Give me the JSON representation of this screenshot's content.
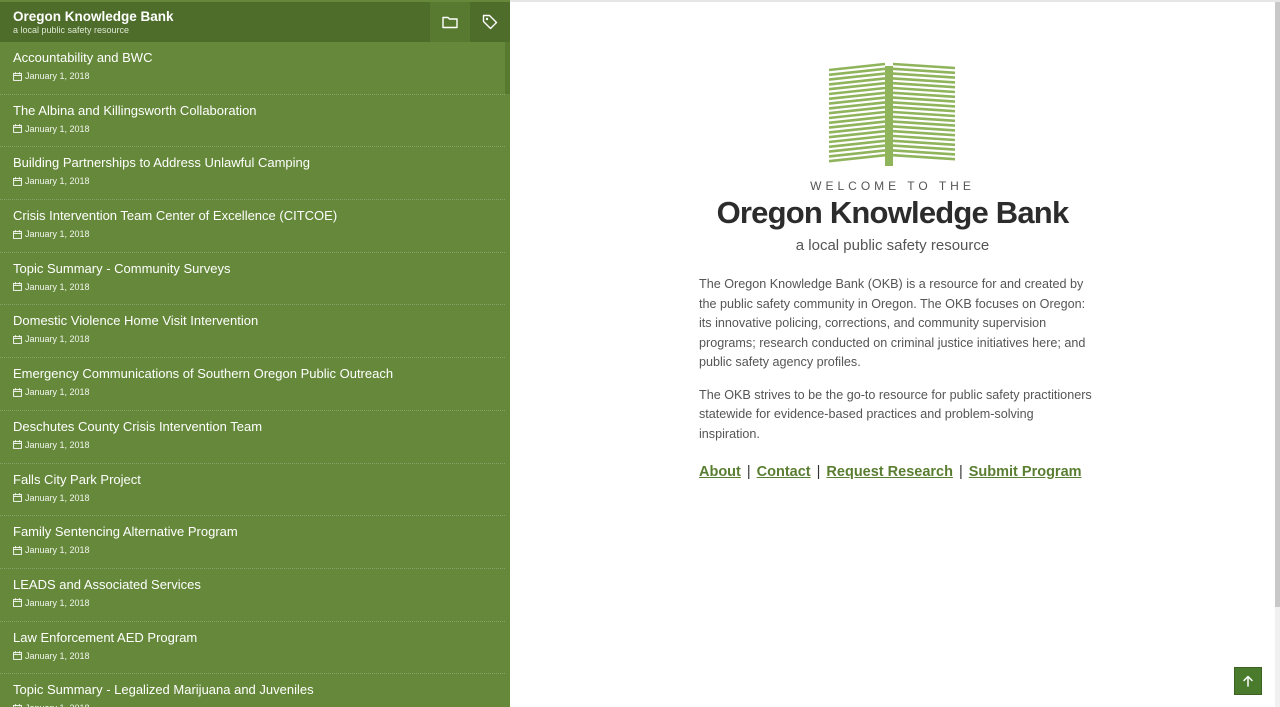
{
  "sidebar": {
    "title": "Oregon Knowledge Bank",
    "subtitle": "a local public safety resource",
    "icons": {
      "folder": "folder-icon",
      "tag": "tag-icon",
      "calendar": "calendar-icon"
    },
    "items": [
      {
        "title": "Accountability and BWC",
        "date": "January 1, 2018"
      },
      {
        "title": "The Albina and Killingsworth Collaboration",
        "date": "January 1, 2018"
      },
      {
        "title": "Building Partnerships to Address Unlawful Camping",
        "date": "January 1, 2018"
      },
      {
        "title": "Crisis Intervention Team Center of Excellence (CITCOE)",
        "date": "January 1, 2018"
      },
      {
        "title": "Topic Summary - Community Surveys",
        "date": "January 1, 2018"
      },
      {
        "title": "Domestic Violence Home Visit Intervention",
        "date": "January 1, 2018"
      },
      {
        "title": "Emergency Communications of Southern Oregon Public Outreach",
        "date": "January 1, 2018"
      },
      {
        "title": "Deschutes County Crisis Intervention Team",
        "date": "January 1, 2018"
      },
      {
        "title": "Falls City Park Project",
        "date": "January 1, 2018"
      },
      {
        "title": "Family Sentencing Alternative Program",
        "date": "January 1, 2018"
      },
      {
        "title": "LEADS and Associated Services",
        "date": "January 1, 2018"
      },
      {
        "title": "Law Enforcement AED Program",
        "date": "January 1, 2018"
      },
      {
        "title": "Topic Summary - Legalized Marijuana and Juveniles",
        "date": "January 1, 2018"
      }
    ]
  },
  "main": {
    "welcome": "WELCOME TO THE",
    "title": "Oregon Knowledge Bank",
    "tagline": "a local public safety resource",
    "paragraph1": "The Oregon Knowledge Bank (OKB) is a resource for and created by the public safety community in Oregon. The OKB focuses on Oregon: its innovative policing, corrections, and community supervision programs; research conducted on criminal justice initiatives here; and public safety agency profiles.",
    "paragraph2": "The OKB strives to be the go-to resource for public safety practitioners statewide for evidence-based practices and problem-solving inspiration.",
    "links": {
      "about": "About",
      "contact": "Contact",
      "request_research": "Request Research",
      "submit_program": "Submit Program",
      "separator": "|"
    },
    "logo_icon": "book-logo-icon"
  },
  "back_to_top_icon": "arrow-up-icon",
  "colors": {
    "sidebar_bg": "#65883a",
    "header_bg": "#4e6d2a",
    "link": "#5a7e31",
    "logo": "#8fb45c"
  }
}
